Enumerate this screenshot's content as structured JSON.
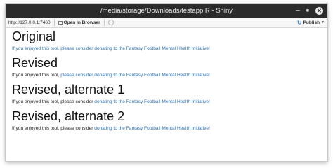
{
  "window": {
    "title": "/media/storage/Downloads/testapp.R - Shiny",
    "minimize_glyph": "–",
    "maximize_glyph": "■",
    "close_glyph": "✕"
  },
  "toolbar": {
    "url": "http://127.0.0.1:7460",
    "open_in_browser": "Open in Browser",
    "publish": "Publish"
  },
  "sections": [
    {
      "title": "Original",
      "all_link": "If you enjoyed this tool, please consider donating to the Fantasy Football Mental Health Initiative!"
    },
    {
      "title": "Revised",
      "plain": "If you enjoyed this tool, ",
      "link": "please consider donating to the Fantasy Football Mental Health Initiative!"
    },
    {
      "title": "Revised, alternate 1",
      "plain": "If you enjoyed this tool, please consider ",
      "link": "donating to the Fantasy Football Mental Health Initiative!"
    },
    {
      "title": "Revised, alternate 2",
      "plain": "If you enjoyed this tool, please consider ",
      "link": "donating to the Fantasy Football Mental Health Initiative",
      "suffix": "!"
    }
  ],
  "colors": {
    "titlebar": "#2b2b2b",
    "link": "#2e72b8",
    "text": "#222222"
  }
}
